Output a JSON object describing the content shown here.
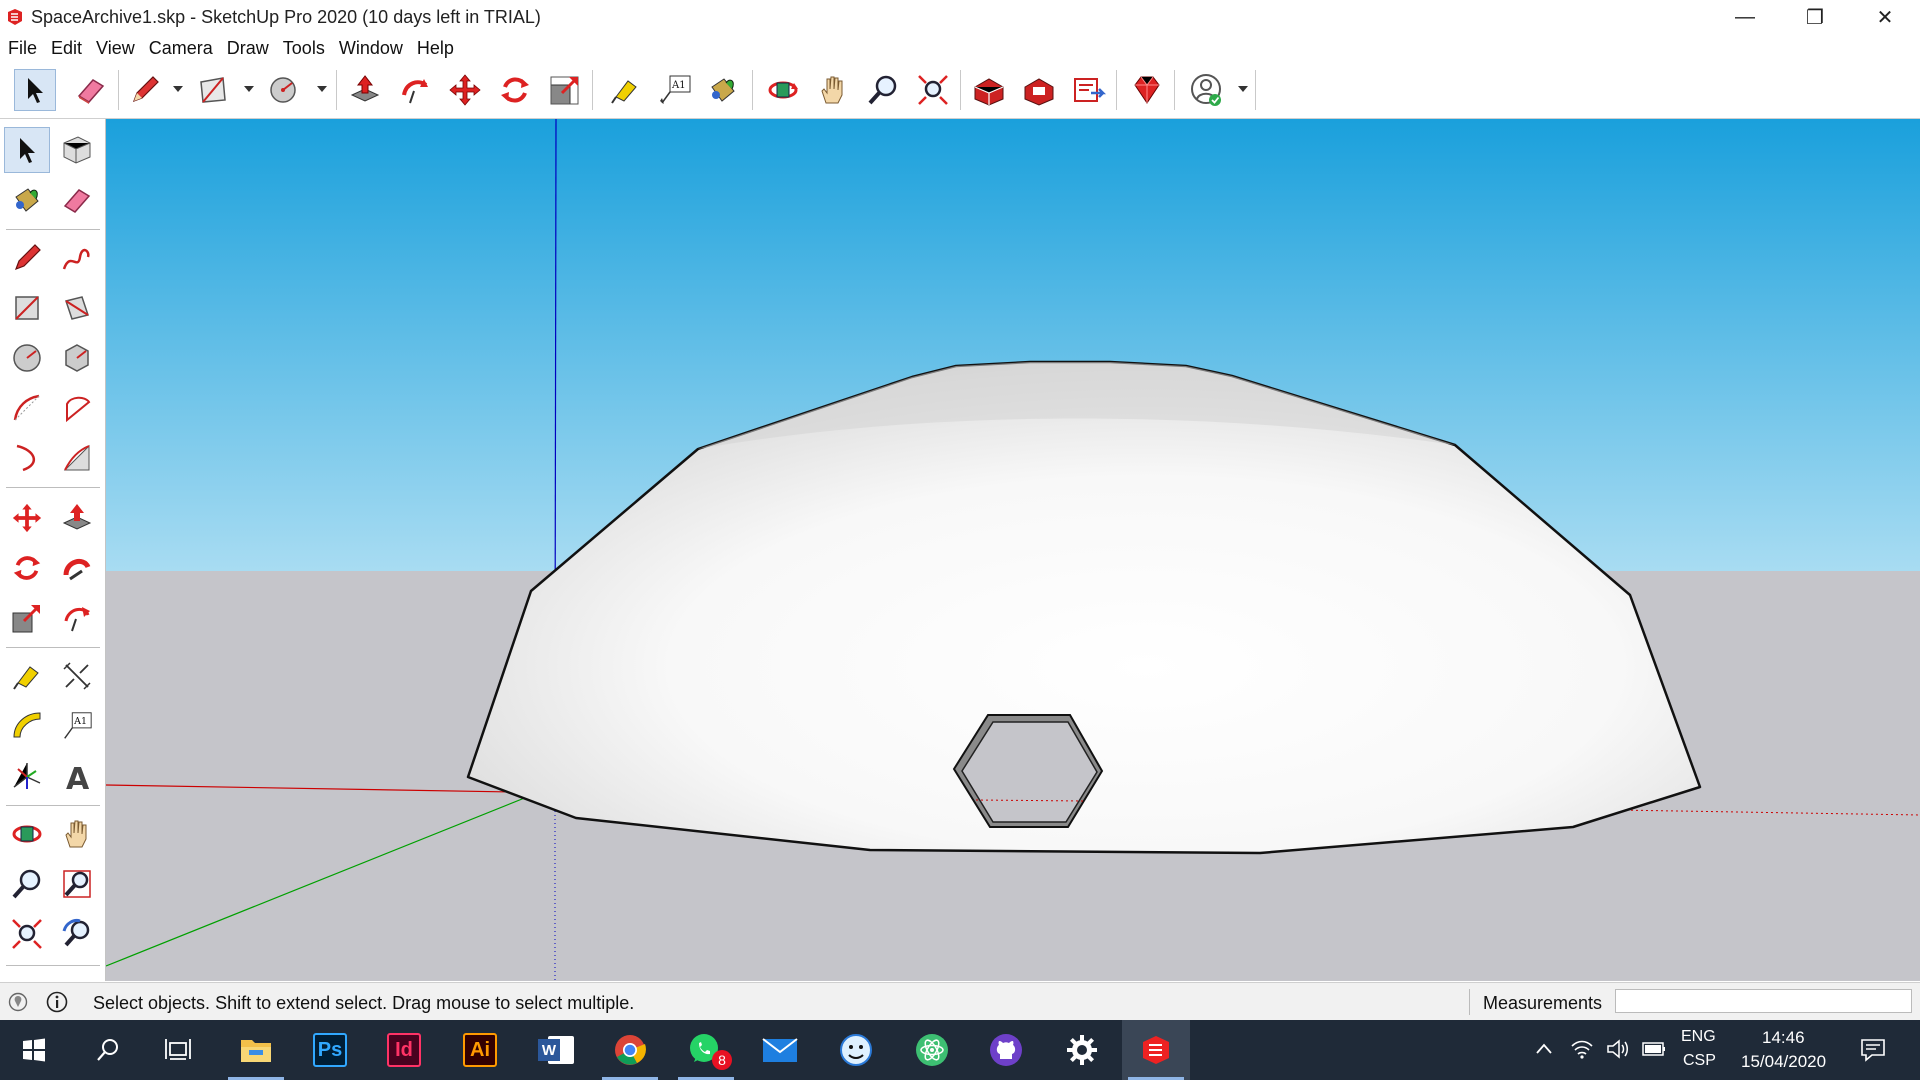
{
  "window": {
    "title": "SpaceArchive1.skp - SketchUp Pro 2020 (10 days left in TRIAL)",
    "minimize_glyph": "—",
    "maximize_glyph": "❐",
    "close_glyph": "✕"
  },
  "menu": [
    "File",
    "Edit",
    "View",
    "Camera",
    "Draw",
    "Tools",
    "Window",
    "Help"
  ],
  "toolbar": {
    "tools": [
      "select-icon",
      "eraser-icon",
      "pencil-icon",
      "rectangle-icon",
      "circle-icon",
      "push-pull-icon",
      "follow-me-icon",
      "move-icon",
      "rotate-icon",
      "scale-icon",
      "tape-measure-icon",
      "text-icon",
      "paint-bucket-icon",
      "orbit-icon",
      "pan-icon",
      "zoom-icon",
      "zoom-extents-icon",
      "warehouse-icon",
      "extension-warehouse-icon",
      "layout-icon",
      "extension-manager-icon",
      "account-icon"
    ],
    "text_tool_label": "A1"
  },
  "left_toolbar": {
    "tools": [
      "select-icon",
      "make-component-icon",
      "paint-bucket-icon",
      "eraser-icon",
      "line-icon",
      "freehand-icon",
      "rectangle-icon",
      "rotated-rectangle-icon",
      "circle-icon",
      "polygon-icon",
      "arc-icon",
      "pie-icon",
      "two-point-arc-icon",
      "three-point-arc-icon",
      "move-icon",
      "push-pull-icon",
      "rotate-icon",
      "follow-me-icon",
      "scale-icon",
      "offset-icon",
      "tape-measure-icon",
      "dimension-icon",
      "protractor-icon",
      "text-icon",
      "axes-icon",
      "3d-text-icon",
      "orbit-icon",
      "pan-icon",
      "zoom-icon",
      "zoom-window-icon",
      "zoom-extents-icon",
      "previous-view-icon"
    ],
    "text_tool_label": "A1",
    "text3d_label": "A"
  },
  "colors": {
    "sky_top": "#1aa0dc",
    "sky_bottom": "#a8dcf2",
    "ground": "#c5c5ca",
    "red_axis": "#cc0000",
    "green_axis": "#00a000",
    "blue_axis": "#0000c0",
    "taskbar": "#1f2a38"
  },
  "status": {
    "text": "Select objects. Shift to extend select. Drag mouse to select multiple.",
    "measurements_label": "Measurements",
    "measurements_value": ""
  },
  "taskbar": {
    "apps": [
      "windows-start-icon",
      "search-icon",
      "task-view-icon",
      "file-explorer-icon",
      "photoshop-icon",
      "indesign-icon",
      "illustrator-icon",
      "word-icon",
      "chrome-icon",
      "whatsapp-icon",
      "mail-icon",
      "finder-like-icon",
      "atom-icon",
      "github-icon",
      "settings-icon",
      "sketchup-icon"
    ],
    "photoshop_label": "Ps",
    "indesign_label": "Id",
    "illustrator_label": "Ai",
    "word_label": "W",
    "whatsapp_badge": "8",
    "language": "ENG",
    "language_sub": "CSP",
    "time": "14:46",
    "date": "15/04/2020"
  }
}
